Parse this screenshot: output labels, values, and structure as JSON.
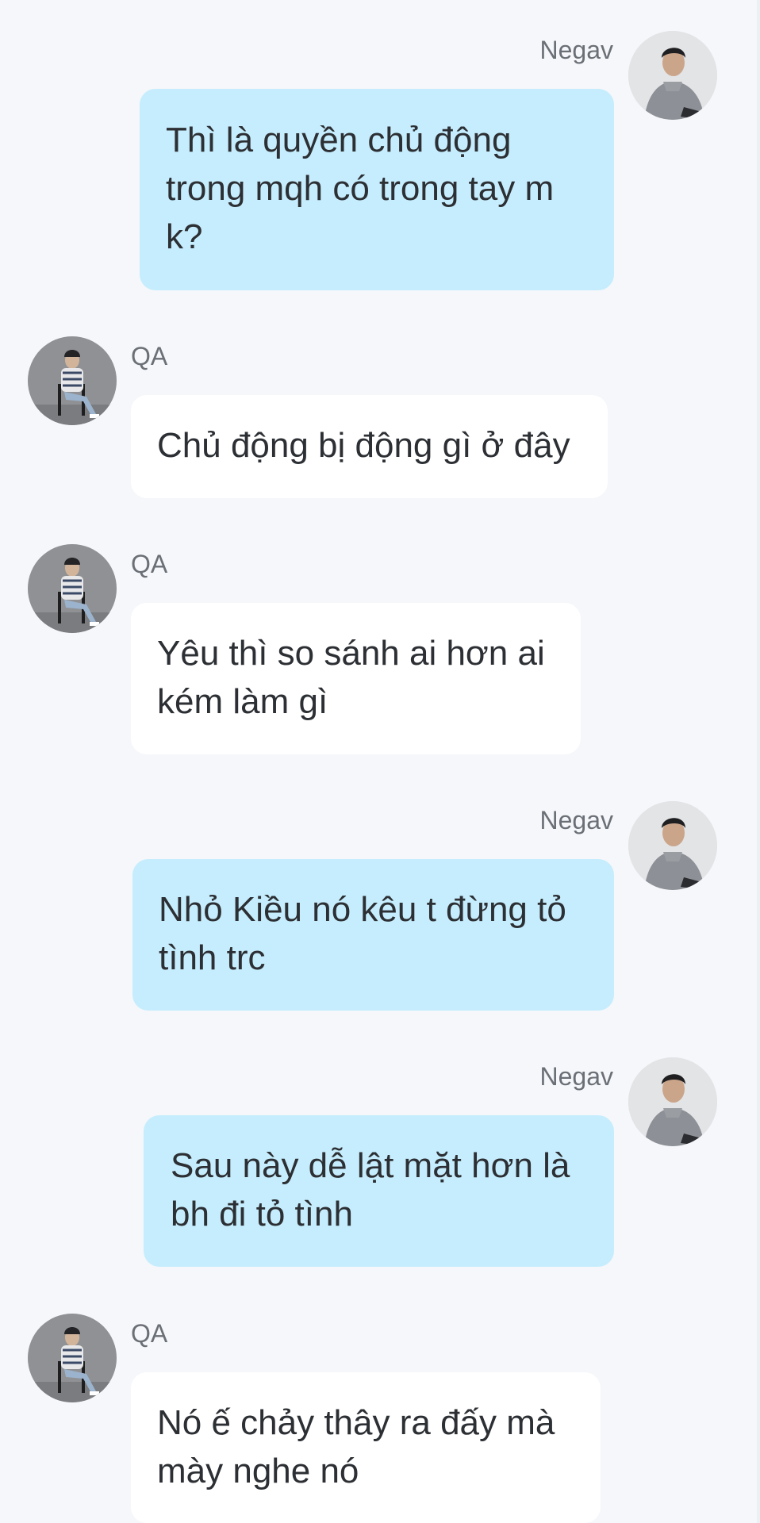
{
  "participants": {
    "negav": {
      "name": "Negav",
      "avatar_icon": "person-portrait-avatar-icon"
    },
    "qa": {
      "name": "QA",
      "avatar_icon": "person-seated-avatar-icon"
    }
  },
  "colors": {
    "background": "#f5f7fa",
    "outgoing_bubble": "#c6edfd",
    "incoming_bubble": "#ffffff",
    "text": "#2c2f33",
    "sender_name": "#6b6f76"
  },
  "messages": [
    {
      "sender": "Negav",
      "direction": "outgoing",
      "text": "Thì là quyền chủ động\ntrong mqh có trong tay m\nk?"
    },
    {
      "sender": "QA",
      "direction": "incoming",
      "text": "Chủ động bị động gì ở đây"
    },
    {
      "sender": "QA",
      "direction": "incoming",
      "text": "Yêu thì so sánh ai hơn ai\nkém làm gì"
    },
    {
      "sender": "Negav",
      "direction": "outgoing",
      "text": "Nhỏ Kiều nó kêu t đừng tỏ\ntình trc"
    },
    {
      "sender": "Negav",
      "direction": "outgoing",
      "text": "Sau này dễ lật mặt hơn là\nbh đi tỏ tình"
    },
    {
      "sender": "QA",
      "direction": "incoming",
      "text": "Nó ế chảy thây ra đấy mà\nmày nghe nó"
    }
  ]
}
